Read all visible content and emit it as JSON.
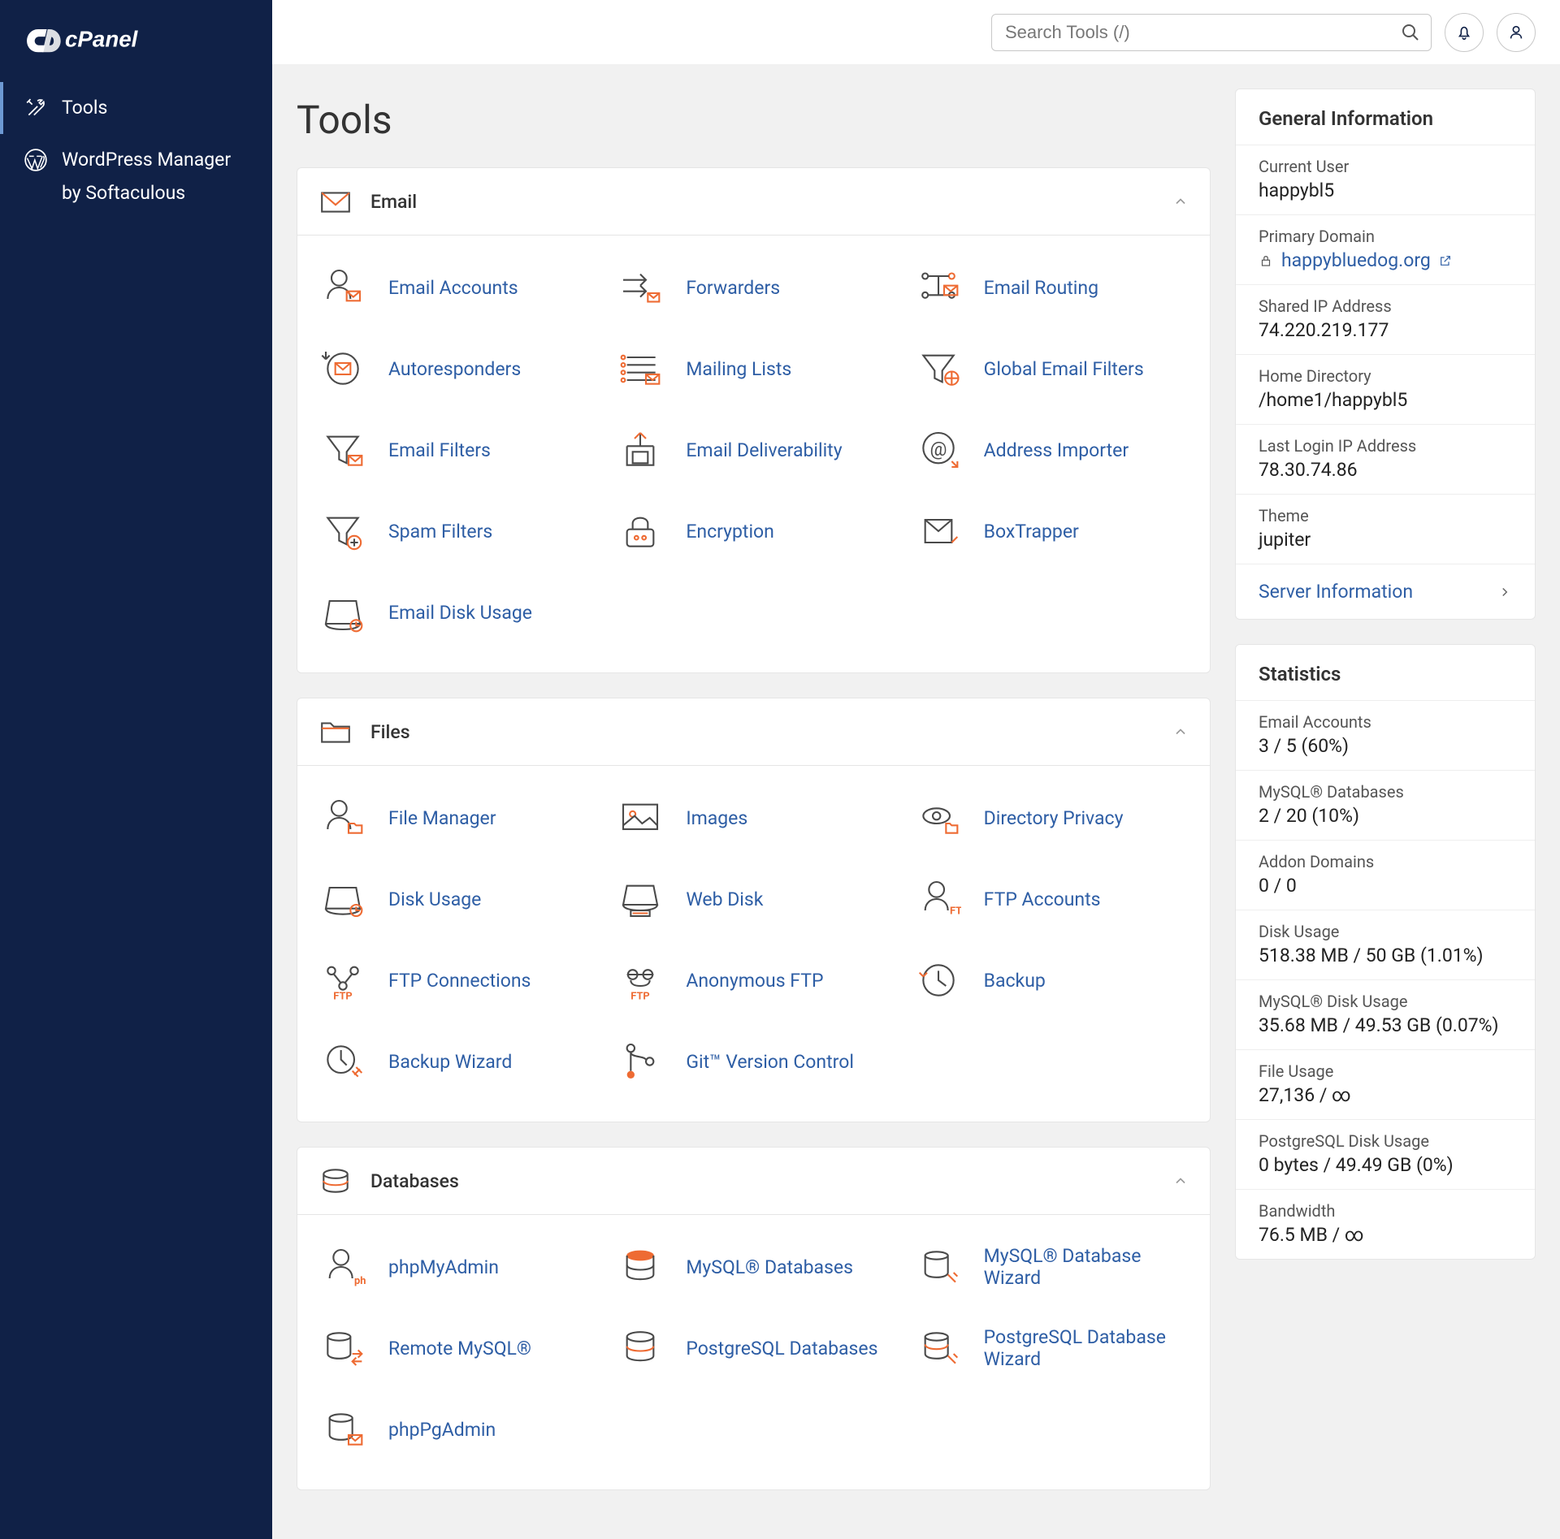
{
  "brand": "cPanel",
  "search": {
    "placeholder": "Search Tools (/)"
  },
  "nav": {
    "tools": "Tools",
    "wp1": "WordPress Manager",
    "wp2": "by Softaculous"
  },
  "page_title": "Tools",
  "sections": {
    "email": {
      "title": "Email",
      "items": [
        "Email Accounts",
        "Forwarders",
        "Email Routing",
        "Autoresponders",
        "Mailing Lists",
        "Global Email Filters",
        "Email Filters",
        "Email Deliverability",
        "Address Importer",
        "Spam Filters",
        "Encryption",
        "BoxTrapper",
        "Email Disk Usage"
      ]
    },
    "files": {
      "title": "Files",
      "items": [
        "File Manager",
        "Images",
        "Directory Privacy",
        "Disk Usage",
        "Web Disk",
        "FTP Accounts",
        "FTP Connections",
        "Anonymous FTP",
        "Backup",
        "Backup Wizard",
        "Git™ Version Control"
      ]
    },
    "db": {
      "title": "Databases",
      "items": [
        "phpMyAdmin",
        "MySQL® Databases",
        "MySQL® Database Wizard",
        "Remote MySQL®",
        "PostgreSQL Databases",
        "PostgreSQL Database Wizard",
        "phpPgAdmin"
      ]
    }
  },
  "general": {
    "title": "General Information",
    "items": [
      {
        "label": "Current User",
        "value": "happybl5"
      },
      {
        "label": "Primary Domain",
        "value": "happybluedog.org",
        "link": true,
        "lock": true
      },
      {
        "label": "Shared IP Address",
        "value": "74.220.219.177"
      },
      {
        "label": "Home Directory",
        "value": "/home1/happybl5"
      },
      {
        "label": "Last Login IP Address",
        "value": "78.30.74.86"
      },
      {
        "label": "Theme",
        "value": "jupiter"
      }
    ],
    "server_link": "Server Information"
  },
  "stats": {
    "title": "Statistics",
    "items": [
      {
        "label": "Email Accounts",
        "value": "3 / 5   (60%)"
      },
      {
        "label": "MySQL® Databases",
        "value": "2 / 20   (10%)"
      },
      {
        "label": "Addon Domains",
        "value": "0 / 0"
      },
      {
        "label": "Disk Usage",
        "value": "518.38 MB / 50 GB   (1.01%)"
      },
      {
        "label": "MySQL® Disk Usage",
        "value": "35.68 MB / 49.53 GB   (0.07%)"
      },
      {
        "label": "File Usage",
        "value": "27,136 / ∞"
      },
      {
        "label": "PostgreSQL Disk Usage",
        "value": "0 bytes / 49.49 GB   (0%)"
      },
      {
        "label": "Bandwidth",
        "value": "76.5 MB / ∞"
      }
    ]
  },
  "icon_names": {
    "email": [
      "email-accounts-icon",
      "forwarders-icon",
      "email-routing-icon",
      "autoresponders-icon",
      "mailing-lists-icon",
      "global-email-filters-icon",
      "email-filters-icon",
      "email-deliverability-icon",
      "address-importer-icon",
      "spam-filters-icon",
      "encryption-icon",
      "boxtrapper-icon",
      "email-disk-usage-icon"
    ],
    "files": [
      "file-manager-icon",
      "images-icon",
      "directory-privacy-icon",
      "disk-usage-icon",
      "web-disk-icon",
      "ftp-accounts-icon",
      "ftp-connections-icon",
      "anonymous-ftp-icon",
      "backup-icon",
      "backup-wizard-icon",
      "git-icon"
    ],
    "db": [
      "phpmyadmin-icon",
      "mysql-databases-icon",
      "mysql-wizard-icon",
      "remote-mysql-icon",
      "postgresql-databases-icon",
      "postgresql-wizard-icon",
      "phppgadmin-icon"
    ]
  }
}
